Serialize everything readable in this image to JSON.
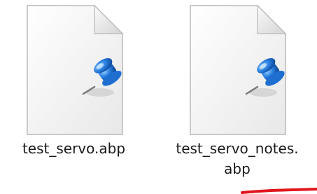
{
  "files": [
    {
      "line1": "test_servo.abp",
      "line2": "",
      "icon": "pushpin-document-icon"
    },
    {
      "line1": "test_servo_notes.",
      "line2": "abp",
      "icon": "pushpin-document-icon"
    }
  ],
  "colors": {
    "pin_blue": "#1f6fd1",
    "page_fill": "#f2f2f2",
    "annotation_red": "#e0161c"
  }
}
